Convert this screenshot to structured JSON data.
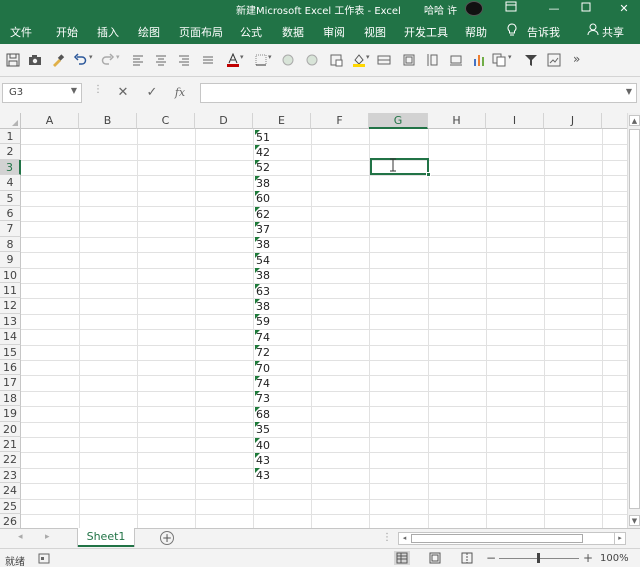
{
  "titlebar": {
    "title": "新建Microsoft Excel 工作表  -  Excel",
    "user": "哈哈 许",
    "controls": [
      "restore-ribbon",
      "minimize",
      "maximize",
      "close"
    ]
  },
  "ribbon": {
    "tabs": [
      "文件",
      "开始",
      "插入",
      "绘图",
      "页面布局",
      "公式",
      "数据",
      "审阅",
      "视图",
      "开发工具",
      "帮助"
    ],
    "tell_me": "告诉我",
    "share": "共享"
  },
  "toolbar": {
    "icons": [
      "save-icon",
      "camera-icon",
      "format-painter-icon",
      "undo-icon",
      "redo-icon",
      "align-left-icon",
      "align-center-icon",
      "align-right-icon",
      "justify-icon",
      "font-color-icon",
      "border-icon",
      "circle-icon",
      "circle-icon",
      "fill-color-icon",
      "shape-icon",
      "frame-icon",
      "height-icon",
      "frame-icon",
      "bar-chart-icon",
      "copy-icon",
      "filter-icon",
      "chart-icon",
      "more-icon"
    ],
    "more_label": "»"
  },
  "formula_bar": {
    "name_box": "G3",
    "cancel": "✕",
    "enter": "✓",
    "fx": "fx",
    "value": ""
  },
  "sheet": {
    "columns": [
      "A",
      "B",
      "C",
      "D",
      "E",
      "F",
      "G",
      "H",
      "I",
      "J"
    ],
    "selected_column": "G",
    "rows": [
      "1",
      "2",
      "3",
      "4",
      "5",
      "6",
      "7",
      "8",
      "9",
      "10",
      "11",
      "12",
      "13",
      "14",
      "15",
      "16",
      "17",
      "18",
      "19",
      "20",
      "21",
      "22",
      "23",
      "24",
      "25",
      "26"
    ],
    "selected_row": "3",
    "selected_cell": "G3",
    "column_e_values": [
      "51",
      "42",
      "52",
      "38",
      "60",
      "62",
      "37",
      "38",
      "54",
      "38",
      "63",
      "38",
      "59",
      "74",
      "72",
      "70",
      "74",
      "73",
      "68",
      "35",
      "40",
      "43",
      "43"
    ]
  },
  "sheet_tabs": {
    "tabs": [
      "Sheet1"
    ],
    "active": "Sheet1"
  },
  "status": {
    "ready": "就绪",
    "zoom": "100%"
  }
}
